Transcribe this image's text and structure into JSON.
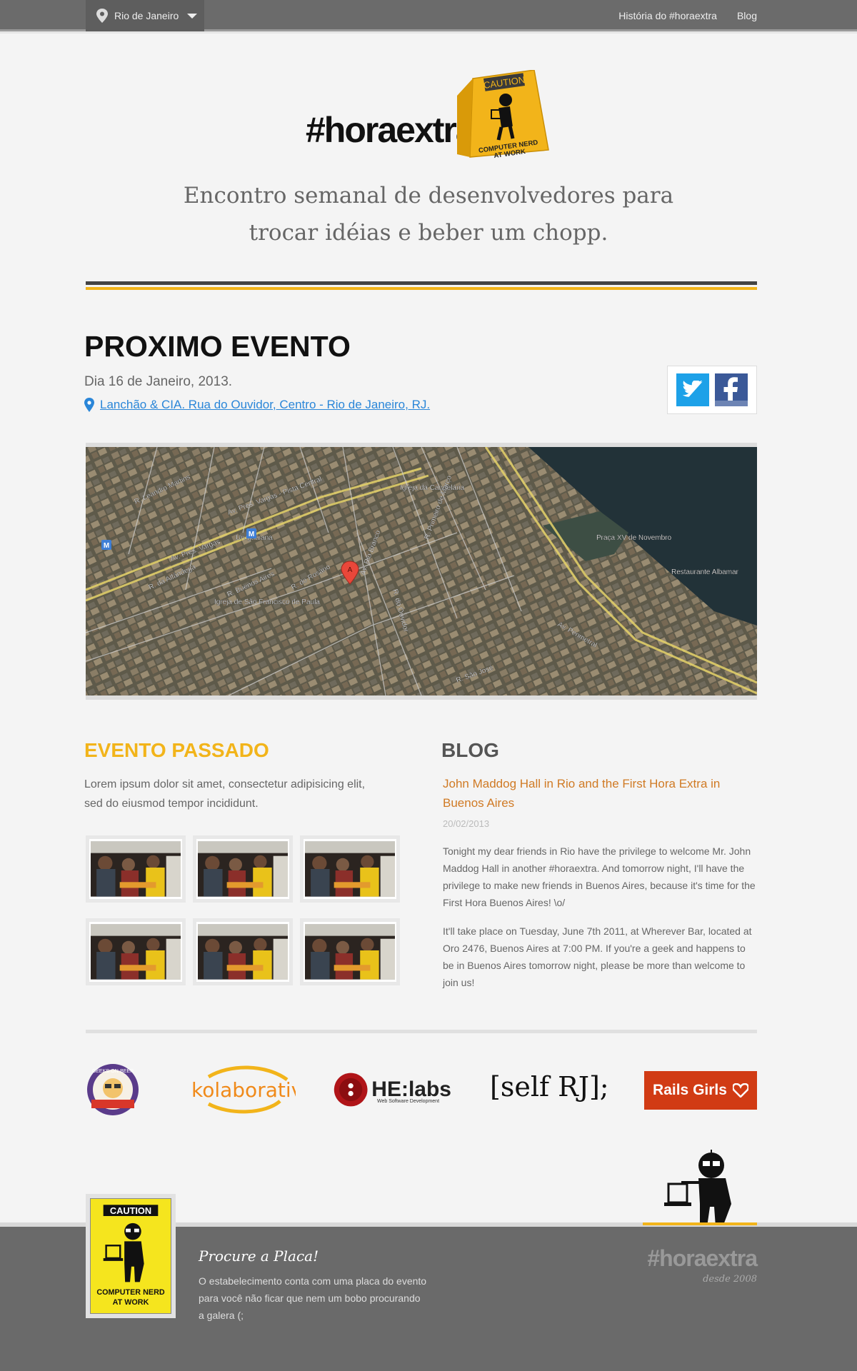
{
  "topbar": {
    "city": "Rio de Janeiro",
    "nav": [
      "História do #horaextra",
      "Blog"
    ]
  },
  "header": {
    "logo": "#horaextra",
    "sign": {
      "top": "CAUTION",
      "line1": "COMPUTER NERD",
      "line2": "AT WORK"
    },
    "tagline_line1": "Encontro semanal de desenvolvedores para",
    "tagline_line2": "trocar idéias e beber um chopp."
  },
  "next_event": {
    "title": "PROXIMO EVENTO",
    "date": "Dia 16 de Janeiro, 2013.",
    "location": "Lanchão & CIA. Rua do Ouvidor, Centro - Rio de Janeiro, RJ.",
    "map_labels": [
      "R. Leandro Martins",
      "Av. Pres. Vargas - Pista Central",
      "Av. Pres. Vargas",
      "Uruguaiana",
      "Igreja da Candelária",
      "R. Primeiro de Março",
      "Av. Rio Branco",
      "Av. Perimetral",
      "Praça XV de Novembro",
      "Restaurante Albamar",
      "Igreja de São Francisco de Paula",
      "R. Buenos Aires",
      "R. da Alfândega",
      "R. do Rosário",
      "R. do Ouvidor",
      "R. São José"
    ],
    "map_pin": "A",
    "colors": {
      "twitter": "#1da1e8",
      "facebook": "#3b5998"
    }
  },
  "past_event": {
    "title": "EVENTO PASSADO",
    "description": "Lorem ipsum dolor sit amet, consectetur adipisicing elit, sed do eiusmod tempor incididunt.",
    "photos": 6
  },
  "blog": {
    "title": "BLOG",
    "post_title": "John Maddog Hall in Rio and the First Hora Extra in Buenos Aires",
    "post_date": "20/02/2013",
    "paragraph1": "Tonight my dear friends in Rio have the privilege to welcome Mr. John Maddog Hall in another #horaextra. And tomorrow night, I'll have the privilege to make new friends in Buenos Aires, because it's time for the First Hora Buenos Aires! \\o/",
    "paragraph2": "It'll take place on Tuesday, June 7th 2011, at Wherever Bar, located at Oro 2476, Buenos Aires at 7:00 PM. If you're a geek and happens to be in Buenos Aires tomorrow night, please be more than welcome to join us!"
  },
  "sponsors": {
    "geeks": "GEEKS-ON-BEER",
    "kolaborativa": "kolaborativa",
    "helabs": "HE:labs",
    "helabs_sub": "Web Software Development",
    "self_rj": "[self RJ];",
    "rails_girls": "Rails Girls"
  },
  "footer": {
    "sign_top": "CAUTION",
    "sign_line1": "COMPUTER NERD",
    "sign_line2": "AT WORK",
    "heading": "Procure a Placa!",
    "text": "O estabelecimento conta com uma placa do evento para você não ficar que nem um bobo procurando a galera (;",
    "brand": "#horaextra",
    "since": "desde 2008"
  },
  "colors": {
    "accent": "#f2b41a",
    "link": "#2a86d8",
    "blog_link": "#d07a24",
    "rails": "#d13b14"
  }
}
